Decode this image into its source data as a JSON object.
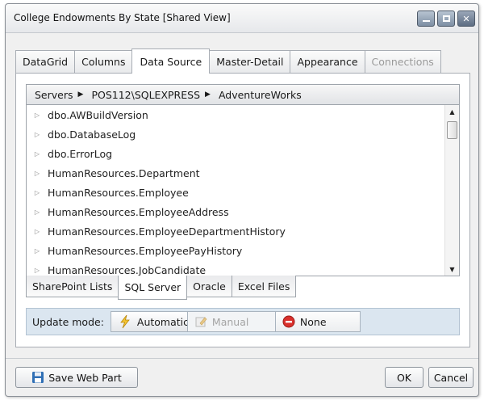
{
  "window": {
    "title": "College Endowments By State [Shared View]",
    "controls": [
      "minimize",
      "maximize",
      "close"
    ]
  },
  "tabs": [
    {
      "label": "DataGrid",
      "state": "normal"
    },
    {
      "label": "Columns",
      "state": "normal"
    },
    {
      "label": "Data Source",
      "state": "active"
    },
    {
      "label": "Master-Detail",
      "state": "normal"
    },
    {
      "label": "Appearance",
      "state": "normal"
    },
    {
      "label": "Connections",
      "state": "disabled"
    }
  ],
  "breadcrumb": [
    {
      "label": "Servers"
    },
    {
      "label": "POS112\\SQLEXPRESS"
    },
    {
      "label": "AdventureWorks"
    }
  ],
  "tree_items": [
    "dbo.AWBuildVersion",
    "dbo.DatabaseLog",
    "dbo.ErrorLog",
    "HumanResources.Department",
    "HumanResources.Employee",
    "HumanResources.EmployeeAddress",
    "HumanResources.EmployeeDepartmentHistory",
    "HumanResources.EmployeePayHistory",
    "HumanResources.JobCandidate"
  ],
  "source_tabs": [
    {
      "label": "SharePoint Lists",
      "state": "normal"
    },
    {
      "label": "SQL Server",
      "state": "active"
    },
    {
      "label": "Oracle",
      "state": "normal"
    },
    {
      "label": "Excel Files",
      "state": "normal"
    }
  ],
  "update_mode": {
    "label": "Update mode:",
    "options": [
      {
        "label": "Automatic",
        "icon": "lightning-icon",
        "state": "active"
      },
      {
        "label": "Manual",
        "icon": "manual-edit-icon",
        "state": "disabled"
      },
      {
        "label": "None",
        "icon": "stop-icon",
        "state": "normal"
      }
    ]
  },
  "footer": {
    "save_label": "Save Web Part",
    "ok_label": "OK",
    "cancel_label": "Cancel"
  },
  "colors": {
    "update_bar": "#dbe6f0",
    "stop_red": "#d9302c",
    "lightning_yellow": "#f4c430",
    "save_blue": "#2f6fb5"
  }
}
